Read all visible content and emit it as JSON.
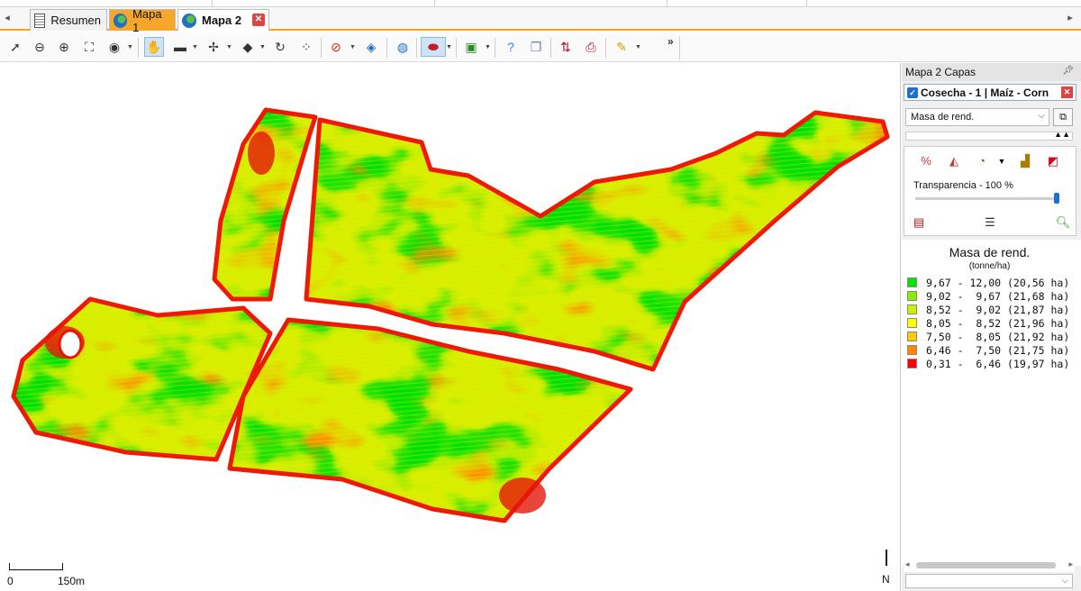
{
  "tabs": [
    {
      "label": "Resumen",
      "icon": "document-icon"
    },
    {
      "label": "Mapa 1",
      "icon": "globe-icon"
    },
    {
      "label": "Mapa 2",
      "icon": "globe-icon",
      "active": true
    }
  ],
  "toolbar": {
    "more_label": "»",
    "tools": [
      "select-arrow-icon",
      "zoom-out-icon",
      "zoom-in-icon",
      "zoom-extent-icon",
      "zoom-layer-icon",
      "pan-hand-icon",
      "measure-ruler-icon",
      "label-abc-icon",
      "eraser-icon",
      "undo-rotate-icon",
      "points-icon",
      "no-filter-icon",
      "layer-stack-icon",
      "globe-add-icon",
      "ellipse-color-icon",
      "select-region-icon",
      "help-icon",
      "copy-map-icon",
      "export-icon",
      "print-icon",
      "note-icon"
    ]
  },
  "map": {
    "scale_zero": "0",
    "scale_label": "150m",
    "north_label": "N",
    "legend_colors": [
      "#00e600",
      "#88ee00",
      "#ccee00",
      "#ffff00",
      "#ffcc00",
      "#ff8800",
      "#ff0000"
    ]
  },
  "panel": {
    "title": "Mapa 2 Capas",
    "layer_name": "Cosecha - 1 | Maíz - Corn",
    "attribute": "Masa de rend.",
    "transparency_label": "Transparencia - 100 %",
    "transparency_value": 100,
    "legend": {
      "title": "Masa de rend.",
      "unit": "(tonne/ha)",
      "rows": [
        {
          "range": "9,67 - 12,00 (20,56 ha)",
          "color": "#00e600"
        },
        {
          "range": "9,02 -  9,67 (21,68 ha)",
          "color": "#88ee00"
        },
        {
          "range": "8,52 -  9,02 (21,87 ha)",
          "color": "#ccee00"
        },
        {
          "range": "8,05 -  8,52 (21,96 ha)",
          "color": "#ffff00"
        },
        {
          "range": "7,50 -  8,05 (21,92 ha)",
          "color": "#ffcc00"
        },
        {
          "range": "6,46 -  7,50 (21,75 ha)",
          "color": "#ff8800"
        },
        {
          "range": "0,31 -  6,46 (19,97 ha)",
          "color": "#ff0000"
        }
      ]
    }
  }
}
